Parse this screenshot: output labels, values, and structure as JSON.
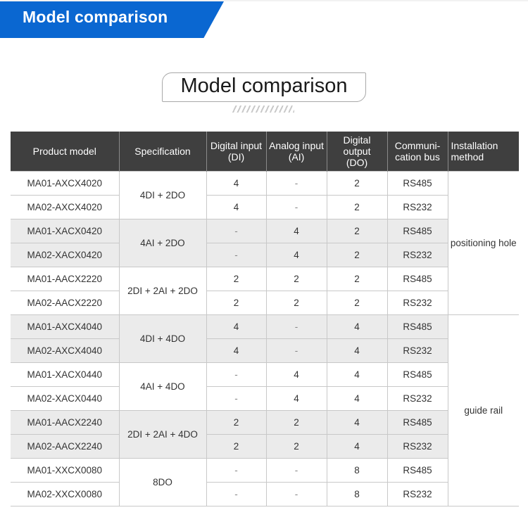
{
  "banner": {
    "title": "Model comparison",
    "color": "#0a67d1"
  },
  "heading": {
    "title": "Model comparison"
  },
  "table": {
    "headers": {
      "model": "Product model",
      "spec": "Specification",
      "di_1": "Digital input",
      "di_2": "(DI)",
      "ai_1": "Analog input",
      "ai_2": "(AI)",
      "do_1": "Digital output",
      "do_2": "(DO)",
      "bus_1": "Communi-",
      "bus_2": "cation bus",
      "inst_1": "Installation",
      "inst_2": "method"
    },
    "groups": [
      {
        "spec": "4DI + 2DO",
        "rows": [
          {
            "model": "MA01-AXCX4020",
            "di": "4",
            "ai": "-",
            "do": "2",
            "bus": "RS485"
          },
          {
            "model": "MA02-AXCX4020",
            "di": "4",
            "ai": "-",
            "do": "2",
            "bus": "RS232"
          }
        ]
      },
      {
        "spec": "4AI + 2DO",
        "rows": [
          {
            "model": "MA01-XACX0420",
            "di": "-",
            "ai": "4",
            "do": "2",
            "bus": "RS485"
          },
          {
            "model": "MA02-XACX0420",
            "di": "-",
            "ai": "4",
            "do": "2",
            "bus": "RS232"
          }
        ]
      },
      {
        "spec": "2DI + 2AI + 2DO",
        "rows": [
          {
            "model": "MA01-AACX2220",
            "di": "2",
            "ai": "2",
            "do": "2",
            "bus": "RS485"
          },
          {
            "model": "MA02-AACX2220",
            "di": "2",
            "ai": "2",
            "do": "2",
            "bus": "RS232"
          }
        ]
      },
      {
        "spec": "4DI + 4DO",
        "rows": [
          {
            "model": "MA01-AXCX4040",
            "di": "4",
            "ai": "-",
            "do": "4",
            "bus": "RS485"
          },
          {
            "model": "MA02-AXCX4040",
            "di": "4",
            "ai": "-",
            "do": "4",
            "bus": "RS232"
          }
        ]
      },
      {
        "spec": "4AI + 4DO",
        "rows": [
          {
            "model": "MA01-XACX0440",
            "di": "-",
            "ai": "4",
            "do": "4",
            "bus": "RS485"
          },
          {
            "model": "MA02-XACX0440",
            "di": "-",
            "ai": "4",
            "do": "4",
            "bus": "RS232"
          }
        ]
      },
      {
        "spec": "2DI + 2AI + 4DO",
        "rows": [
          {
            "model": "MA01-AACX2240",
            "di": "2",
            "ai": "2",
            "do": "4",
            "bus": "RS485"
          },
          {
            "model": "MA02-AACX2240",
            "di": "2",
            "ai": "2",
            "do": "4",
            "bus": "RS232"
          }
        ]
      },
      {
        "spec": "8DO",
        "rows": [
          {
            "model": "MA01-XXCX0080",
            "di": "-",
            "ai": "-",
            "do": "8",
            "bus": "RS485"
          },
          {
            "model": "MA02-XXCX0080",
            "di": "-",
            "ai": "-",
            "do": "8",
            "bus": "RS232"
          }
        ]
      }
    ],
    "installation": [
      {
        "label": "positioning hole",
        "groups": 3
      },
      {
        "label": "guide rail",
        "groups": 4
      }
    ]
  }
}
